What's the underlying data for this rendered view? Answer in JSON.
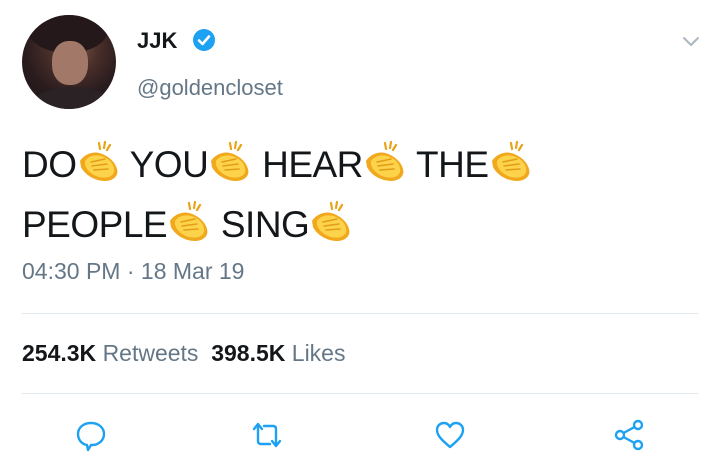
{
  "tweet": {
    "author": {
      "name": "JJK",
      "handle": "@goldencloset",
      "verified": true
    },
    "text_words": [
      "DO",
      "YOU",
      "HEAR",
      "THE",
      "PEOPLE",
      "SING"
    ],
    "emoji": "clapping-hands-icon",
    "time": "04:30 PM",
    "separator": "·",
    "date": "18 Mar 19",
    "retweets": {
      "count": "254.3K",
      "label": "Retweets"
    },
    "likes": {
      "count": "398.5K",
      "label": "Likes"
    }
  },
  "actions": [
    {
      "icon": "reply-icon"
    },
    {
      "icon": "retweet-icon"
    },
    {
      "icon": "like-icon"
    },
    {
      "icon": "share-icon"
    }
  ],
  "colors": {
    "accent": "#1da1f2",
    "secondary_text": "#657786",
    "divider": "#e1e8ed",
    "clap": "#f5b731"
  }
}
